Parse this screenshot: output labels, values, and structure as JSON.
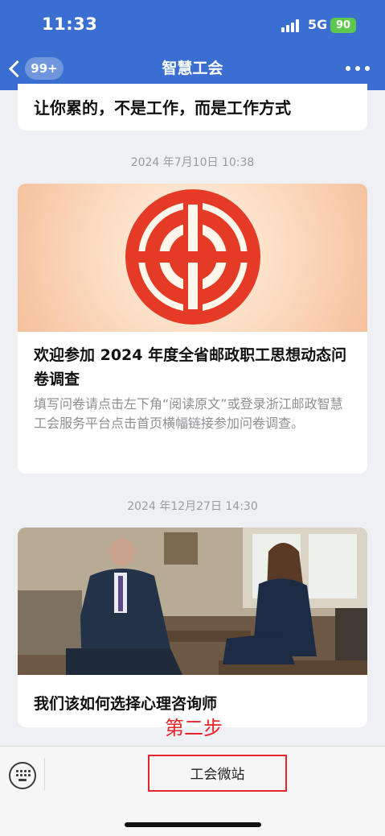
{
  "status": {
    "time": "11:33",
    "network": "5G",
    "battery": "90"
  },
  "nav": {
    "badge": "99+",
    "title": "智慧工会"
  },
  "articles": [
    {
      "title": "让你累的，不是工作，而是工作方式"
    },
    {
      "timestamp": "2024 年7月10日 10:38",
      "title": "欢迎参加 2024 年度全省邮政职工思想动态问卷调查",
      "desc": "填写问卷请点击左下角“阅读原文”或登录浙江邮政智慧工会服务平台点击首页横幅链接参加问卷调查。"
    },
    {
      "timestamp": "2024 年12月27日 14:30",
      "title": "我们该如何选择心理咨询师"
    }
  ],
  "annotation": {
    "text": "第二步",
    "color": "#e4252a"
  },
  "bottom_bar": {
    "menu_label": "工会微站"
  },
  "colors": {
    "header": "#3a6fd1",
    "battery": "#5cc84d",
    "highlight": "#e3262b"
  },
  "icons": [
    "back-icon",
    "more-icon",
    "keyboard-icon",
    "union-logo-icon"
  ]
}
